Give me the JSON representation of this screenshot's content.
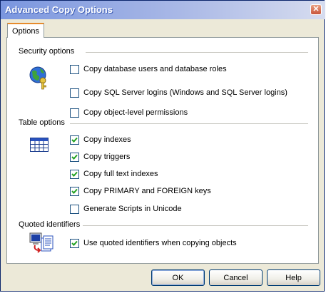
{
  "window": {
    "title": "Advanced Copy Options",
    "close_glyph": "✕"
  },
  "tabs": [
    {
      "label": "Options"
    }
  ],
  "security": {
    "label": "Security options",
    "icon": "security-globe-key-icon",
    "items": [
      {
        "label": "Copy database users and database roles",
        "checked": false
      },
      {
        "label": "Copy SQL Server logins (Windows and SQL Server logins)",
        "checked": false
      },
      {
        "label": "Copy object-level permissions",
        "checked": false
      }
    ]
  },
  "table": {
    "label": "Table options",
    "icon": "table-icon",
    "items": [
      {
        "label": "Copy indexes",
        "checked": true
      },
      {
        "label": "Copy triggers",
        "checked": true
      },
      {
        "label": "Copy full text indexes",
        "checked": true
      },
      {
        "label": "Copy PRIMARY and FOREIGN keys",
        "checked": true
      },
      {
        "label": "Generate Scripts in Unicode",
        "checked": false
      }
    ]
  },
  "quoted": {
    "label": "Quoted identifiers",
    "icon": "quoted-identifiers-icon",
    "items": [
      {
        "label": "Use quoted identifiers when copying objects",
        "checked": true
      }
    ]
  },
  "buttons": {
    "ok": "OK",
    "cancel": "Cancel",
    "help": "Help"
  }
}
